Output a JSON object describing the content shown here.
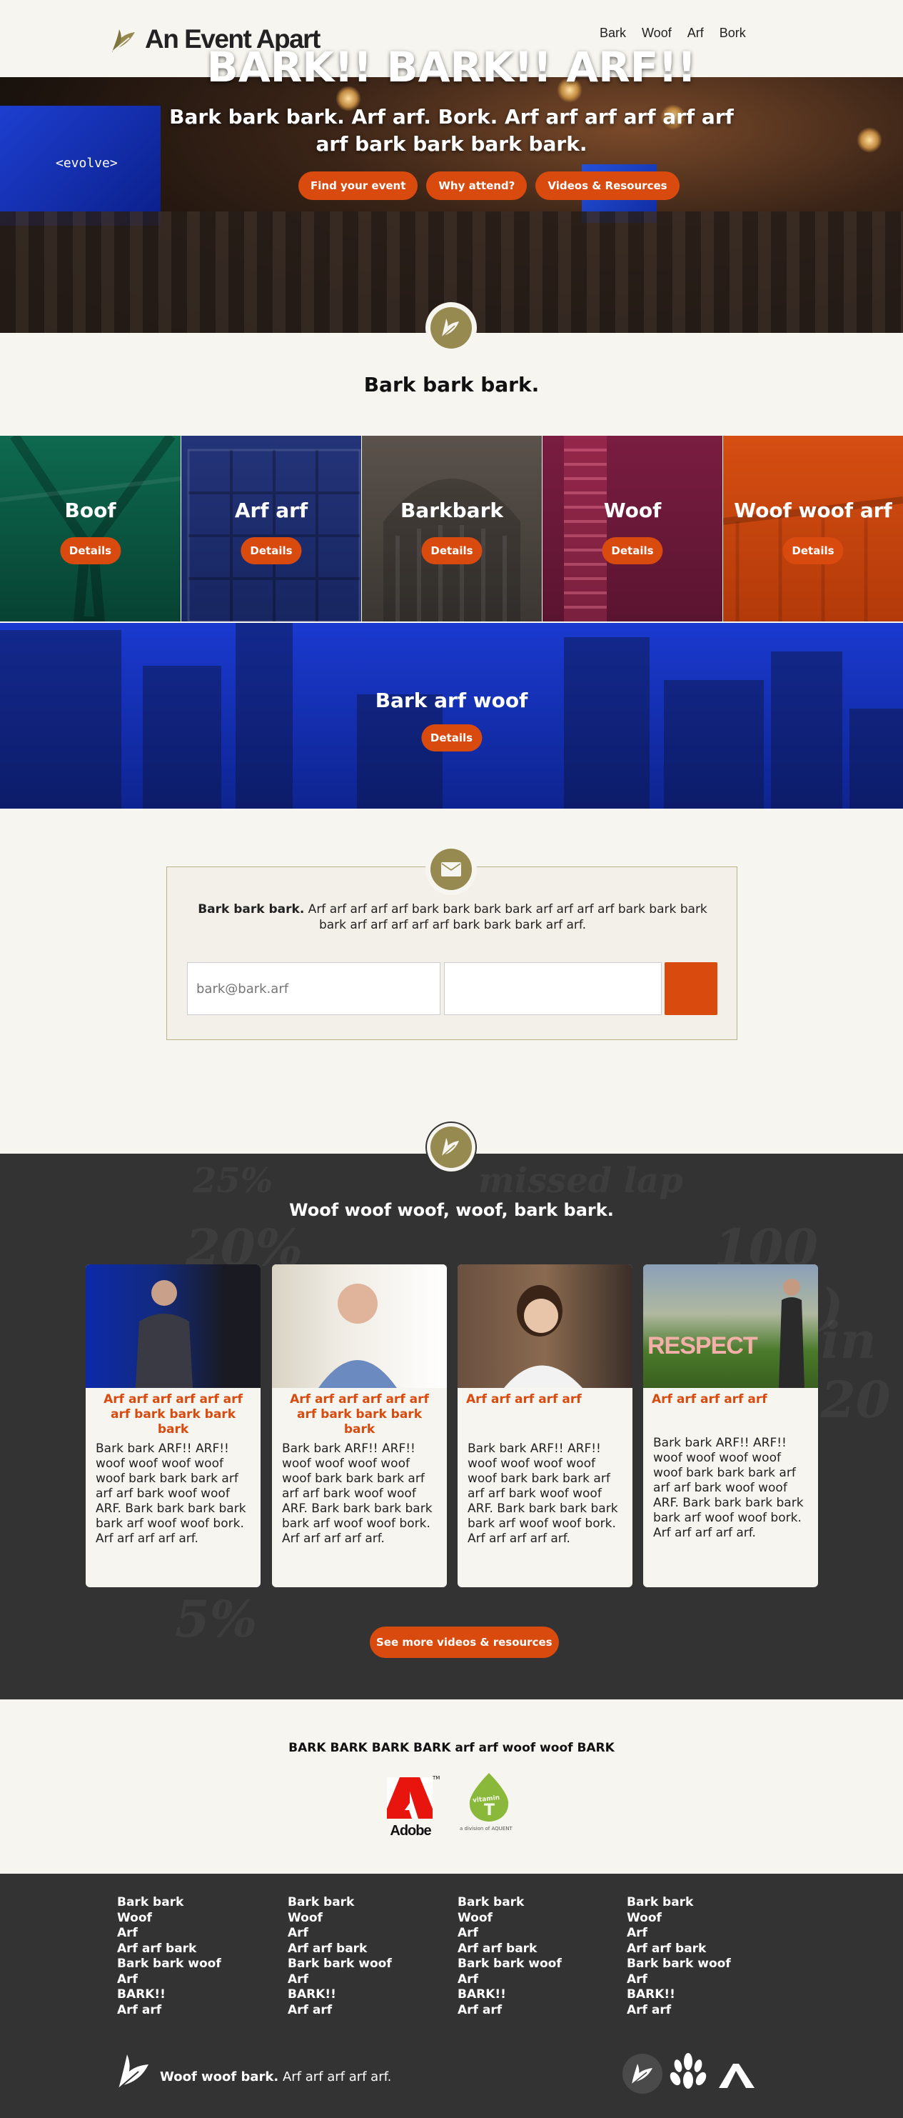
{
  "header": {
    "logo_text": "An Event Apart",
    "nav": [
      "Bark",
      "Woof",
      "Arf",
      "Bork"
    ]
  },
  "hero": {
    "screen_text": "<evolve>",
    "title": "BARK!! BARK!! ARF!!",
    "subtitle": "Bark bark bark. Arf arf. Bork. Arf arf arf arf arf arf arf bark bark bark bark.",
    "buttons": [
      "Find your event",
      "Why attend?",
      "Videos & Resources"
    ]
  },
  "events": {
    "title": "Bark bark bark.",
    "tiles": [
      {
        "name": "Boof",
        "button": "Details",
        "color": "#0b5d45"
      },
      {
        "name": "Arf arf",
        "button": "Details",
        "color": "#1c2c6e"
      },
      {
        "name": "Barkbark",
        "button": "Details",
        "color": "#4a4540"
      },
      {
        "name": "Woof",
        "button": "Details",
        "color": "#6e1838"
      },
      {
        "name": "Woof woof arf",
        "button": "Details",
        "color": "#cc4210"
      },
      {
        "name": "Bark arf woof",
        "button": "Details",
        "color": "#122aa0"
      }
    ]
  },
  "newsletter": {
    "bold": "Bark bark bark.",
    "text": " Arf arf arf arf arf bark bark bark bark arf arf arf arf bark bark bark bark arf arf arf arf arf bark bark bark arf arf.",
    "email_placeholder": "bark@bark.arf"
  },
  "videos": {
    "title": "Woof woof woof, woof, bark bark.",
    "background_text": [
      "25%",
      "missed lap",
      "20%",
      "100 (1%)",
      "in 20",
      "5%"
    ],
    "cards": [
      {
        "title": "Arf arf arf arf arf arf arf bark bark bark bark",
        "desc": "Bark bark ARF!! ARF!! woof woof woof woof woof bark bark bark arf arf arf bark woof woof ARF. Bark bark bark bark bark arf woof woof bork. Arf arf arf arf arf."
      },
      {
        "title": "Arf arf arf arf arf arf arf bark bark bark bark",
        "desc": "Bark bark ARF!! ARF!! woof woof woof woof woof bark bark bark arf arf arf bark woof woof ARF. Bark bark bark bark bark arf woof woof bork. Arf arf arf arf arf."
      },
      {
        "title": "Arf arf arf arf arf",
        "desc": "Bark bark ARF!! ARF!! woof woof woof woof woof bark bark bark arf arf arf bark woof woof ARF. Bark bark bark bark bark arf woof woof bork. Arf arf arf arf arf."
      },
      {
        "title": "Arf arf arf arf arf",
        "desc": "Bark bark ARF!! ARF!! woof woof woof woof woof bark bark bark arf arf arf bark woof woof ARF. Bark bark bark bark bark arf woof woof bork. Arf arf arf arf arf."
      }
    ],
    "card_photo_labels": [
      "",
      "",
      "",
      "RESPECT"
    ],
    "more_button": "See more videos & resources"
  },
  "sponsors": {
    "title": "BARK BARK BARK BARK arf arf woof woof BARK",
    "adobe": "Adobe",
    "tm": "TM",
    "vitamin": "vitamin",
    "vitamin_t": "T",
    "aquent": "a division of AQUENT"
  },
  "footer": {
    "columns": [
      [
        "Bark bark",
        "Woof",
        "Arf",
        "Arf arf bark",
        "Bark bark woof",
        "Arf",
        "BARK!!",
        "Arf arf"
      ],
      [
        "Bark bark",
        "Woof",
        "Arf",
        "Arf arf bark",
        "Bark bark woof",
        "Arf",
        "BARK!!",
        "Arf arf"
      ],
      [
        "Bark bark",
        "Woof",
        "Arf",
        "Arf arf bark",
        "Bark bark woof",
        "Arf",
        "BARK!!",
        "Arf arf"
      ],
      [
        "Bark bark",
        "Woof",
        "Arf",
        "Arf arf bark",
        "Bark bark woof",
        "Arf",
        "BARK!!",
        "Arf arf"
      ]
    ],
    "tagline_bold": "Woof woof bark.",
    "tagline": " Arf arf arf arf arf."
  },
  "colors": {
    "accent": "#d84a0e",
    "olive": "#968a50",
    "dark": "#333333",
    "background": "#f7f5ef"
  }
}
